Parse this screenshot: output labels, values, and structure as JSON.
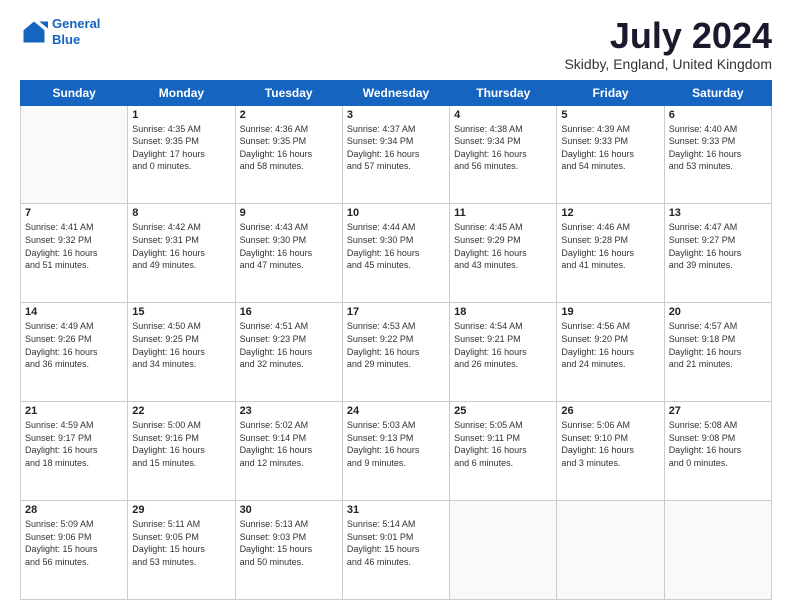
{
  "header": {
    "logo_line1": "General",
    "logo_line2": "Blue",
    "month_title": "July 2024",
    "location": "Skidby, England, United Kingdom"
  },
  "days_of_week": [
    "Sunday",
    "Monday",
    "Tuesday",
    "Wednesday",
    "Thursday",
    "Friday",
    "Saturday"
  ],
  "weeks": [
    [
      {
        "day": "",
        "info": ""
      },
      {
        "day": "1",
        "info": "Sunrise: 4:35 AM\nSunset: 9:35 PM\nDaylight: 17 hours\nand 0 minutes."
      },
      {
        "day": "2",
        "info": "Sunrise: 4:36 AM\nSunset: 9:35 PM\nDaylight: 16 hours\nand 58 minutes."
      },
      {
        "day": "3",
        "info": "Sunrise: 4:37 AM\nSunset: 9:34 PM\nDaylight: 16 hours\nand 57 minutes."
      },
      {
        "day": "4",
        "info": "Sunrise: 4:38 AM\nSunset: 9:34 PM\nDaylight: 16 hours\nand 56 minutes."
      },
      {
        "day": "5",
        "info": "Sunrise: 4:39 AM\nSunset: 9:33 PM\nDaylight: 16 hours\nand 54 minutes."
      },
      {
        "day": "6",
        "info": "Sunrise: 4:40 AM\nSunset: 9:33 PM\nDaylight: 16 hours\nand 53 minutes."
      }
    ],
    [
      {
        "day": "7",
        "info": "Sunrise: 4:41 AM\nSunset: 9:32 PM\nDaylight: 16 hours\nand 51 minutes."
      },
      {
        "day": "8",
        "info": "Sunrise: 4:42 AM\nSunset: 9:31 PM\nDaylight: 16 hours\nand 49 minutes."
      },
      {
        "day": "9",
        "info": "Sunrise: 4:43 AM\nSunset: 9:30 PM\nDaylight: 16 hours\nand 47 minutes."
      },
      {
        "day": "10",
        "info": "Sunrise: 4:44 AM\nSunset: 9:30 PM\nDaylight: 16 hours\nand 45 minutes."
      },
      {
        "day": "11",
        "info": "Sunrise: 4:45 AM\nSunset: 9:29 PM\nDaylight: 16 hours\nand 43 minutes."
      },
      {
        "day": "12",
        "info": "Sunrise: 4:46 AM\nSunset: 9:28 PM\nDaylight: 16 hours\nand 41 minutes."
      },
      {
        "day": "13",
        "info": "Sunrise: 4:47 AM\nSunset: 9:27 PM\nDaylight: 16 hours\nand 39 minutes."
      }
    ],
    [
      {
        "day": "14",
        "info": "Sunrise: 4:49 AM\nSunset: 9:26 PM\nDaylight: 16 hours\nand 36 minutes."
      },
      {
        "day": "15",
        "info": "Sunrise: 4:50 AM\nSunset: 9:25 PM\nDaylight: 16 hours\nand 34 minutes."
      },
      {
        "day": "16",
        "info": "Sunrise: 4:51 AM\nSunset: 9:23 PM\nDaylight: 16 hours\nand 32 minutes."
      },
      {
        "day": "17",
        "info": "Sunrise: 4:53 AM\nSunset: 9:22 PM\nDaylight: 16 hours\nand 29 minutes."
      },
      {
        "day": "18",
        "info": "Sunrise: 4:54 AM\nSunset: 9:21 PM\nDaylight: 16 hours\nand 26 minutes."
      },
      {
        "day": "19",
        "info": "Sunrise: 4:56 AM\nSunset: 9:20 PM\nDaylight: 16 hours\nand 24 minutes."
      },
      {
        "day": "20",
        "info": "Sunrise: 4:57 AM\nSunset: 9:18 PM\nDaylight: 16 hours\nand 21 minutes."
      }
    ],
    [
      {
        "day": "21",
        "info": "Sunrise: 4:59 AM\nSunset: 9:17 PM\nDaylight: 16 hours\nand 18 minutes."
      },
      {
        "day": "22",
        "info": "Sunrise: 5:00 AM\nSunset: 9:16 PM\nDaylight: 16 hours\nand 15 minutes."
      },
      {
        "day": "23",
        "info": "Sunrise: 5:02 AM\nSunset: 9:14 PM\nDaylight: 16 hours\nand 12 minutes."
      },
      {
        "day": "24",
        "info": "Sunrise: 5:03 AM\nSunset: 9:13 PM\nDaylight: 16 hours\nand 9 minutes."
      },
      {
        "day": "25",
        "info": "Sunrise: 5:05 AM\nSunset: 9:11 PM\nDaylight: 16 hours\nand 6 minutes."
      },
      {
        "day": "26",
        "info": "Sunrise: 5:06 AM\nSunset: 9:10 PM\nDaylight: 16 hours\nand 3 minutes."
      },
      {
        "day": "27",
        "info": "Sunrise: 5:08 AM\nSunset: 9:08 PM\nDaylight: 16 hours\nand 0 minutes."
      }
    ],
    [
      {
        "day": "28",
        "info": "Sunrise: 5:09 AM\nSunset: 9:06 PM\nDaylight: 15 hours\nand 56 minutes."
      },
      {
        "day": "29",
        "info": "Sunrise: 5:11 AM\nSunset: 9:05 PM\nDaylight: 15 hours\nand 53 minutes."
      },
      {
        "day": "30",
        "info": "Sunrise: 5:13 AM\nSunset: 9:03 PM\nDaylight: 15 hours\nand 50 minutes."
      },
      {
        "day": "31",
        "info": "Sunrise: 5:14 AM\nSunset: 9:01 PM\nDaylight: 15 hours\nand 46 minutes."
      },
      {
        "day": "",
        "info": ""
      },
      {
        "day": "",
        "info": ""
      },
      {
        "day": "",
        "info": ""
      }
    ]
  ]
}
